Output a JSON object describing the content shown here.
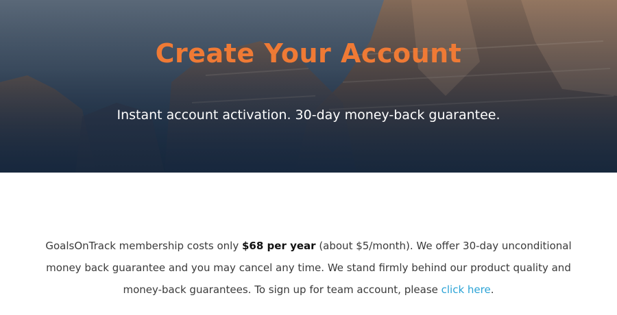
{
  "hero": {
    "title": "Create Your Account",
    "subtitle": "Instant account activation. 30-day money-back guarantee.",
    "title_color": "#ef7a35",
    "background_image": "mountain-cliffs"
  },
  "intro": {
    "text_before_price": "GoalsOnTrack membership costs only ",
    "price": "$68 per year",
    "text_after_price": " (about $5/month). We offer 30-day unconditional money back guarantee and you may cancel any time. We stand firmly behind our product quality and money-back guarantees. To sign up for team account, please ",
    "link_label": "click here",
    "text_end": ".",
    "link_color": "#2aa3d6"
  }
}
